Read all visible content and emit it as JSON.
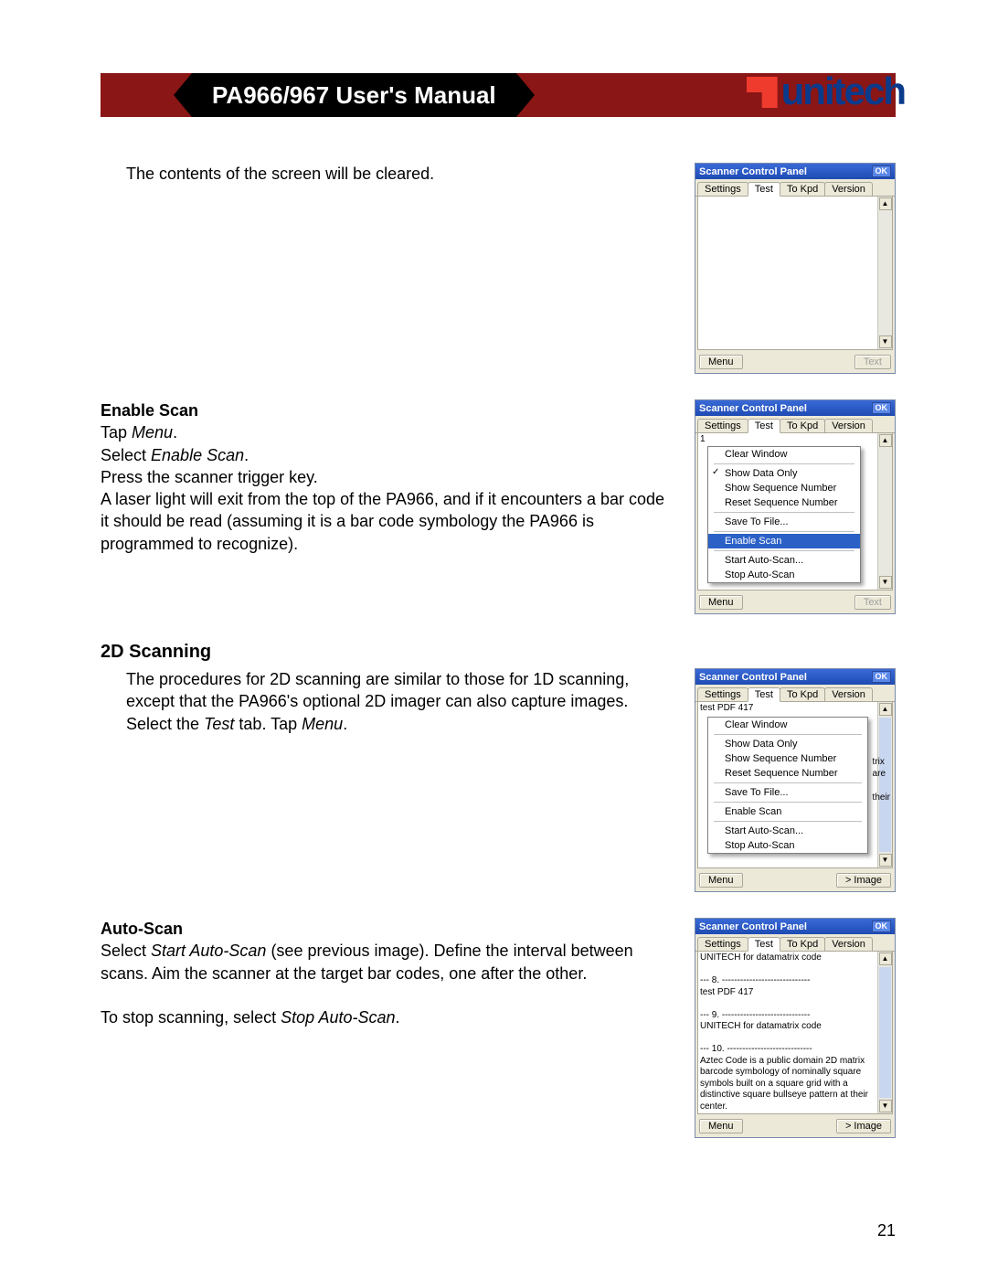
{
  "header": {
    "title": "PA966/967 User's Manual",
    "brand": "unitech"
  },
  "page_number": "21",
  "intro_line": "The contents of the screen will be cleared.",
  "enable_scan": {
    "heading": "Enable Scan",
    "l1a": "Tap ",
    "l1b": "Menu",
    "l1c": ".",
    "l2a": "Select ",
    "l2b": "Enable Scan",
    "l2c": ".",
    "l3": "Press the scanner trigger key.",
    "l4": "A laser light will exit from the top of the PA966, and if it encounters a bar code it should be read (assuming it is a bar code symbology the PA966 is programmed to recognize)."
  },
  "section_2d": {
    "heading": "2D Scanning",
    "p1a": "The procedures for 2D scanning are similar to those for 1D scanning, except that the PA966's optional 2D imager can also capture images. Select the ",
    "p1b": "Test",
    "p1c": " tab.  Tap ",
    "p1d": "Menu",
    "p1e": "."
  },
  "auto_scan": {
    "heading": "Auto-Scan",
    "p1a": "Select ",
    "p1b": "Start Auto-Scan",
    "p1c": " (see previous image).  Define the interval between scans.  Aim the scanner at the target bar codes, one after the other.",
    "p2a": "To stop scanning, select ",
    "p2b": "Stop Auto-Scan",
    "p2c": "."
  },
  "scp": {
    "title": "Scanner Control Panel",
    "ok": "OK",
    "tabs": [
      "Settings",
      "Test",
      "To Kpd",
      "Version"
    ],
    "menu_btn": "Menu",
    "text_btn": "Text",
    "image_btn": "> Image",
    "popup_items": {
      "clear_window": "Clear Window",
      "show_data_only": "Show Data Only",
      "show_seq": "Show Sequence Number",
      "reset_seq": "Reset Sequence Number",
      "save_to_file": "Save To File...",
      "enable_scan": "Enable Scan",
      "start_auto": "Start Auto-Scan...",
      "stop_auto": "Stop Auto-Scan"
    },
    "shot2_behind": "1",
    "shot3_input": "test PDF 417",
    "shot3_behind": [
      "trix",
      "are",
      "their"
    ],
    "shot4_lines": [
      "UNITECH for datamatrix code",
      "",
      "--- 8. -----------------------------",
      "test PDF 417",
      "",
      "--- 9. -----------------------------",
      "UNITECH for datamatrix code",
      "",
      "--- 10. ----------------------------",
      "Aztec Code is a public domain 2D matrix barcode symbology of nominally square symbols built on a square grid with a distinctive square bullseye pattern at their center."
    ]
  }
}
